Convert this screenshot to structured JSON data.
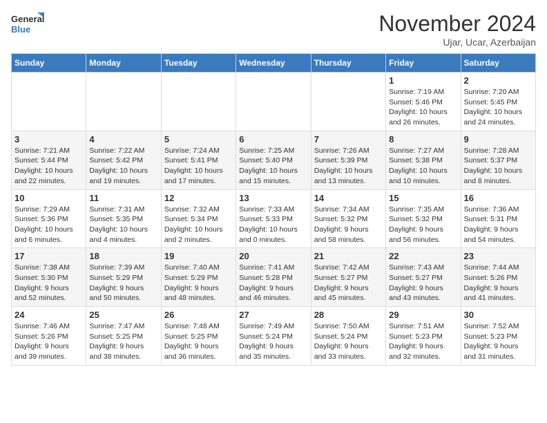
{
  "header": {
    "logo_line1": "General",
    "logo_line2": "Blue",
    "month_title": "November 2024",
    "location": "Ujar, Ucar, Azerbaijan"
  },
  "days_of_week": [
    "Sunday",
    "Monday",
    "Tuesday",
    "Wednesday",
    "Thursday",
    "Friday",
    "Saturday"
  ],
  "weeks": [
    [
      {
        "day": "",
        "info": ""
      },
      {
        "day": "",
        "info": ""
      },
      {
        "day": "",
        "info": ""
      },
      {
        "day": "",
        "info": ""
      },
      {
        "day": "",
        "info": ""
      },
      {
        "day": "1",
        "info": "Sunrise: 7:19 AM\nSunset: 5:46 PM\nDaylight: 10 hours\nand 26 minutes."
      },
      {
        "day": "2",
        "info": "Sunrise: 7:20 AM\nSunset: 5:45 PM\nDaylight: 10 hours\nand 24 minutes."
      }
    ],
    [
      {
        "day": "3",
        "info": "Sunrise: 7:21 AM\nSunset: 5:44 PM\nDaylight: 10 hours\nand 22 minutes."
      },
      {
        "day": "4",
        "info": "Sunrise: 7:22 AM\nSunset: 5:42 PM\nDaylight: 10 hours\nand 19 minutes."
      },
      {
        "day": "5",
        "info": "Sunrise: 7:24 AM\nSunset: 5:41 PM\nDaylight: 10 hours\nand 17 minutes."
      },
      {
        "day": "6",
        "info": "Sunrise: 7:25 AM\nSunset: 5:40 PM\nDaylight: 10 hours\nand 15 minutes."
      },
      {
        "day": "7",
        "info": "Sunrise: 7:26 AM\nSunset: 5:39 PM\nDaylight: 10 hours\nand 13 minutes."
      },
      {
        "day": "8",
        "info": "Sunrise: 7:27 AM\nSunset: 5:38 PM\nDaylight: 10 hours\nand 10 minutes."
      },
      {
        "day": "9",
        "info": "Sunrise: 7:28 AM\nSunset: 5:37 PM\nDaylight: 10 hours\nand 8 minutes."
      }
    ],
    [
      {
        "day": "10",
        "info": "Sunrise: 7:29 AM\nSunset: 5:36 PM\nDaylight: 10 hours\nand 6 minutes."
      },
      {
        "day": "11",
        "info": "Sunrise: 7:31 AM\nSunset: 5:35 PM\nDaylight: 10 hours\nand 4 minutes."
      },
      {
        "day": "12",
        "info": "Sunrise: 7:32 AM\nSunset: 5:34 PM\nDaylight: 10 hours\nand 2 minutes."
      },
      {
        "day": "13",
        "info": "Sunrise: 7:33 AM\nSunset: 5:33 PM\nDaylight: 10 hours\nand 0 minutes."
      },
      {
        "day": "14",
        "info": "Sunrise: 7:34 AM\nSunset: 5:32 PM\nDaylight: 9 hours\nand 58 minutes."
      },
      {
        "day": "15",
        "info": "Sunrise: 7:35 AM\nSunset: 5:32 PM\nDaylight: 9 hours\nand 56 minutes."
      },
      {
        "day": "16",
        "info": "Sunrise: 7:36 AM\nSunset: 5:31 PM\nDaylight: 9 hours\nand 54 minutes."
      }
    ],
    [
      {
        "day": "17",
        "info": "Sunrise: 7:38 AM\nSunset: 5:30 PM\nDaylight: 9 hours\nand 52 minutes."
      },
      {
        "day": "18",
        "info": "Sunrise: 7:39 AM\nSunset: 5:29 PM\nDaylight: 9 hours\nand 50 minutes."
      },
      {
        "day": "19",
        "info": "Sunrise: 7:40 AM\nSunset: 5:29 PM\nDaylight: 9 hours\nand 48 minutes."
      },
      {
        "day": "20",
        "info": "Sunrise: 7:41 AM\nSunset: 5:28 PM\nDaylight: 9 hours\nand 46 minutes."
      },
      {
        "day": "21",
        "info": "Sunrise: 7:42 AM\nSunset: 5:27 PM\nDaylight: 9 hours\nand 45 minutes."
      },
      {
        "day": "22",
        "info": "Sunrise: 7:43 AM\nSunset: 5:27 PM\nDaylight: 9 hours\nand 43 minutes."
      },
      {
        "day": "23",
        "info": "Sunrise: 7:44 AM\nSunset: 5:26 PM\nDaylight: 9 hours\nand 41 minutes."
      }
    ],
    [
      {
        "day": "24",
        "info": "Sunrise: 7:46 AM\nSunset: 5:26 PM\nDaylight: 9 hours\nand 39 minutes."
      },
      {
        "day": "25",
        "info": "Sunrise: 7:47 AM\nSunset: 5:25 PM\nDaylight: 9 hours\nand 38 minutes."
      },
      {
        "day": "26",
        "info": "Sunrise: 7:48 AM\nSunset: 5:25 PM\nDaylight: 9 hours\nand 36 minutes."
      },
      {
        "day": "27",
        "info": "Sunrise: 7:49 AM\nSunset: 5:24 PM\nDaylight: 9 hours\nand 35 minutes."
      },
      {
        "day": "28",
        "info": "Sunrise: 7:50 AM\nSunset: 5:24 PM\nDaylight: 9 hours\nand 33 minutes."
      },
      {
        "day": "29",
        "info": "Sunrise: 7:51 AM\nSunset: 5:23 PM\nDaylight: 9 hours\nand 32 minutes."
      },
      {
        "day": "30",
        "info": "Sunrise: 7:52 AM\nSunset: 5:23 PM\nDaylight: 9 hours\nand 31 minutes."
      }
    ]
  ]
}
